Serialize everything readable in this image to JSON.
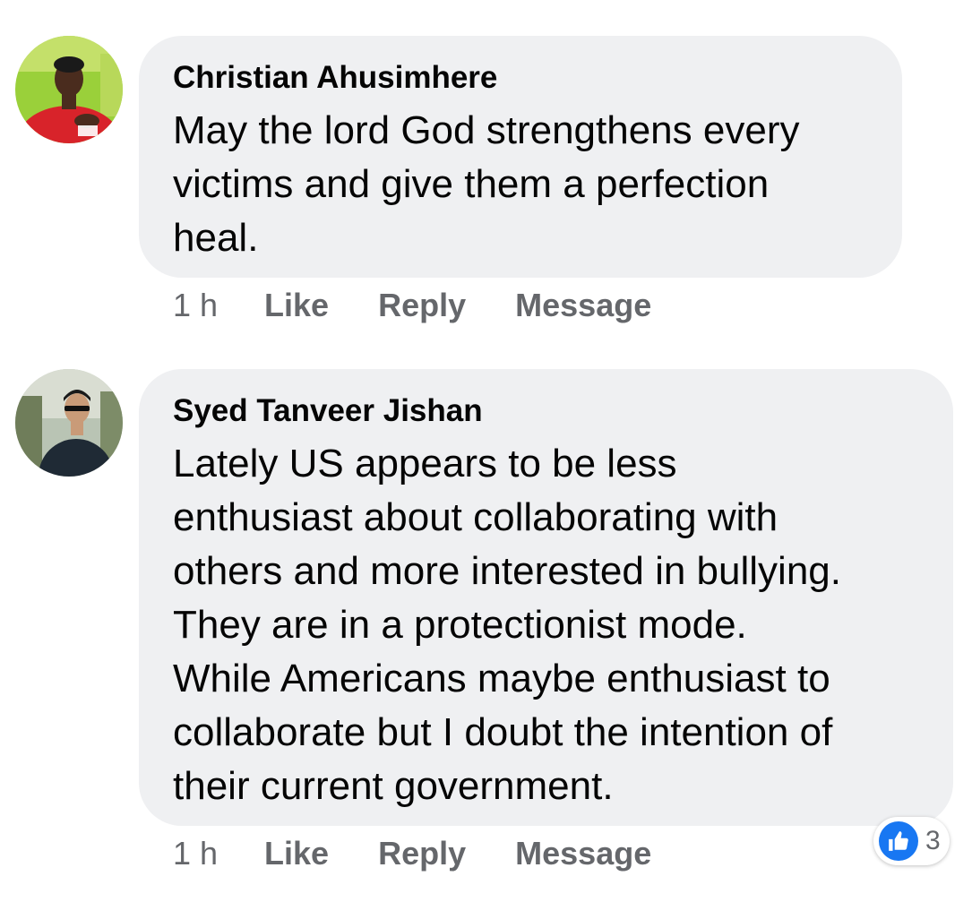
{
  "colors": {
    "bubble_bg": "#eff0f2",
    "meta_text": "#65676b",
    "like_blue": "#1877f2"
  },
  "comments": [
    {
      "author": "Christian Ahusimhere",
      "avatar_icon": "profile-photo",
      "text_lines": [
        "May the lord God strengthens every",
        "victims and give them a perfection",
        "heal."
      ],
      "time": "1 h",
      "actions": [
        "Like",
        "Reply",
        "Message"
      ]
    },
    {
      "author": "Syed Tanveer Jishan",
      "avatar_icon": "profile-photo",
      "text_lines": [
        "Lately US appears to be less",
        "enthusiast about collaborating with",
        "others and more interested in bullying.",
        "They are in a protectionist mode.",
        "While Americans maybe enthusiast to",
        "collaborate but I doubt the intention of",
        "their current government."
      ],
      "time": "1 h",
      "actions": [
        "Like",
        "Reply",
        "Message"
      ],
      "reaction": {
        "icon": "thumbs-up-icon",
        "count": "3"
      }
    }
  ]
}
